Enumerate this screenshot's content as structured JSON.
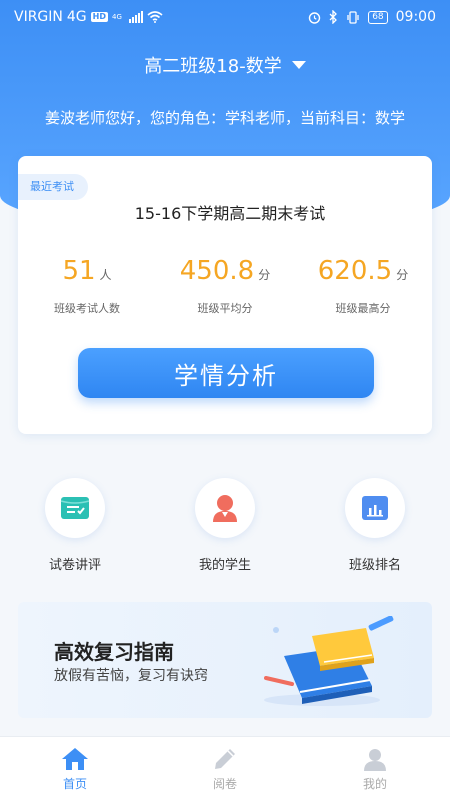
{
  "status_bar": {
    "carrier": "VIRGIN",
    "network": "4G",
    "hd": "HD",
    "small_network": "4G",
    "battery": "68",
    "time": "09:00"
  },
  "header": {
    "class_name": "高二班级18-数学",
    "greeting": "姜波老师您好，您的角色：学科老师，当前科目：数学"
  },
  "exam_card": {
    "tag": "最近考试",
    "title": "15-16下学期高二期末考试",
    "stats": [
      {
        "value": "51",
        "unit": "人",
        "label": "班级考试人数"
      },
      {
        "value": "450.8",
        "unit": "分",
        "label": "班级平均分"
      },
      {
        "value": "620.5",
        "unit": "分",
        "label": "班级最高分"
      }
    ],
    "button_label": "学情分析"
  },
  "shortcuts": [
    {
      "label": "试卷讲评",
      "icon": "paper-review-icon"
    },
    {
      "label": "我的学生",
      "icon": "student-icon"
    },
    {
      "label": "班级排名",
      "icon": "ranking-chart-icon"
    }
  ],
  "banner": {
    "title": "高效复习指南",
    "subtitle": "放假有苦恼，复习有诀窍"
  },
  "tabbar": [
    {
      "label": "首页",
      "icon": "home-icon",
      "active": true
    },
    {
      "label": "阅卷",
      "icon": "pen-icon",
      "active": false
    },
    {
      "label": "我的",
      "icon": "user-icon",
      "active": false
    }
  ],
  "colors": {
    "primary": "#3d8ff5",
    "accent": "#f5a623"
  }
}
